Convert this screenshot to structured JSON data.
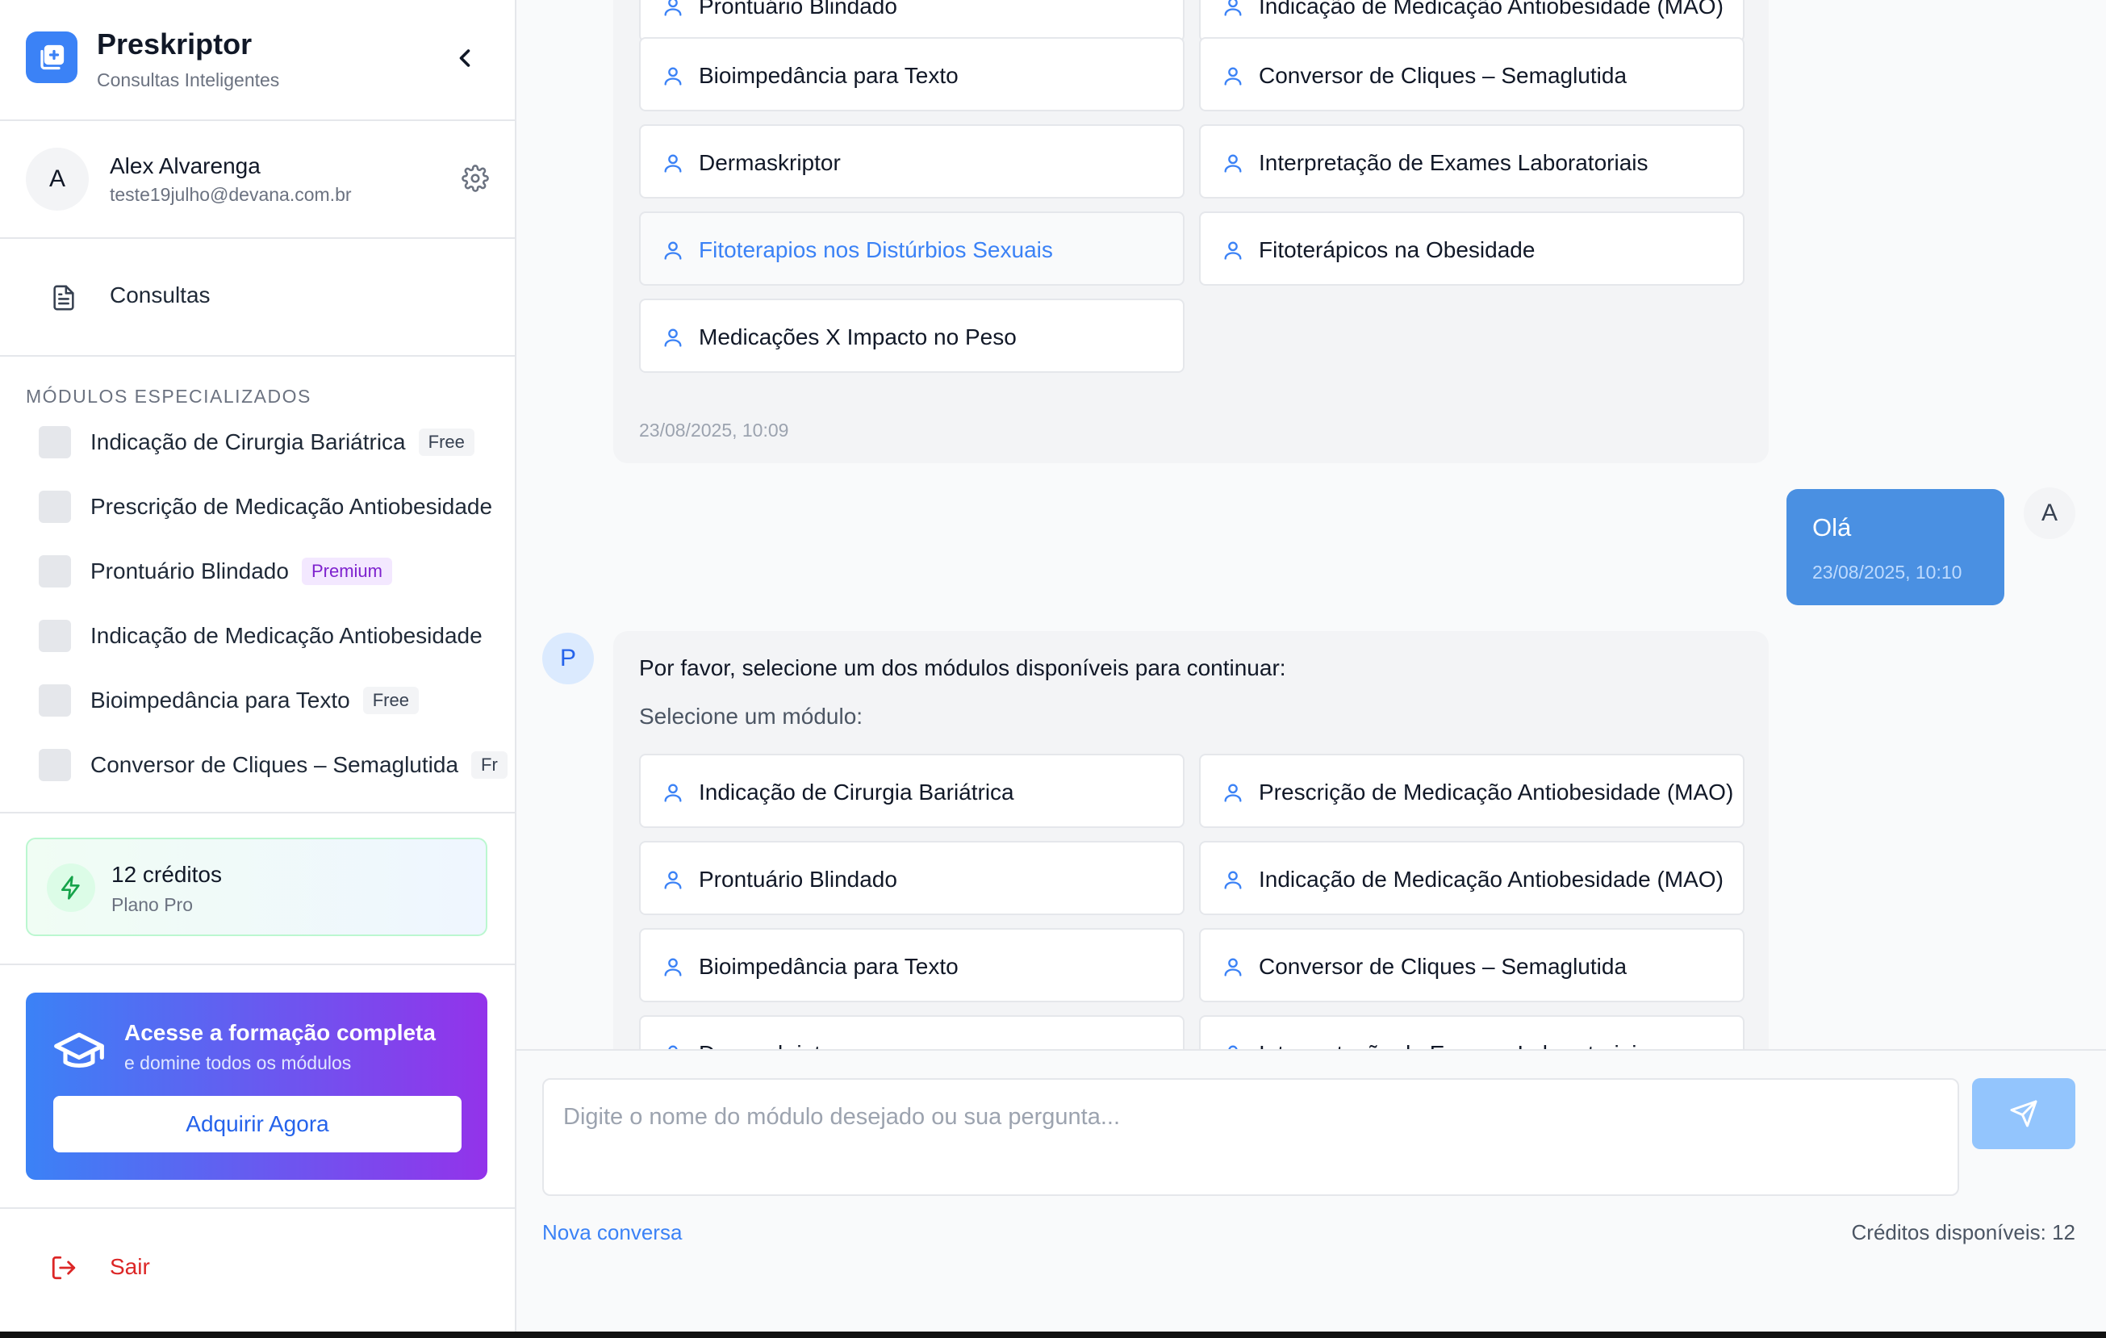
{
  "app": {
    "name": "Preskriptor",
    "subtitle": "Consultas Inteligentes"
  },
  "user": {
    "initial": "A",
    "name": "Alex Alvarenga",
    "email": "teste19julho@devana.com.br"
  },
  "nav": {
    "consultas": "Consultas"
  },
  "modules": {
    "section_title": "MÓDULOS ESPECIALIZADOS",
    "items": [
      {
        "label": "Indicação de Cirurgia Bariátrica",
        "badge": "Free"
      },
      {
        "label": "Prescrição de Medicação Antiobesidade",
        "badge": ""
      },
      {
        "label": "Prontuário Blindado",
        "badge": "Premium"
      },
      {
        "label": "Indicação de Medicação Antiobesidade",
        "badge": ""
      },
      {
        "label": "Bioimpedância para Texto",
        "badge": "Free"
      },
      {
        "label": "Conversor de Cliques – Semaglutida",
        "badge": "Fr"
      }
    ]
  },
  "credits_card": {
    "amount": "12 créditos",
    "plan": "Plano Pro"
  },
  "promo": {
    "title": "Acesse a formação completa",
    "subtitle": "e domine todos os módulos",
    "button": "Adquirir Agora"
  },
  "logout": "Sair",
  "chat": {
    "first_bot": {
      "modules": [
        "Prontuário Blindado",
        "Indicação de Medicação Antiobesidade (MAO)",
        "Bioimpedância para Texto",
        "Conversor de Cliques – Semaglutida",
        "Dermaskriptor",
        "Interpretação de Exames Laboratoriais",
        "Fitoterapios nos Distúrbios Sexuais",
        "Fitoterápicos na Obesidade",
        "Medicações X Impacto no Peso"
      ],
      "timestamp": "23/08/2025, 10:09"
    },
    "user_msg": {
      "text": "Olá",
      "timestamp": "23/08/2025, 10:10",
      "avatar": "A"
    },
    "second_bot": {
      "avatar": "P",
      "intro": "Por favor, selecione um dos módulos disponíveis para continuar:",
      "select_hint": "Selecione um módulo:",
      "modules": [
        "Indicação de Cirurgia Bariátrica",
        "Prescrição de Medicação Antiobesidade (MAO)",
        "Prontuário Blindado",
        "Indicação de Medicação Antiobesidade (MAO)",
        "Bioimpedância para Texto",
        "Conversor de Cliques – Semaglutida",
        "Dermaskriptor",
        "Interpretação de Exames Laboratoriais"
      ]
    }
  },
  "input": {
    "placeholder": "Digite o nome do módulo desejado ou sua pergunta...",
    "value": "",
    "new_chat": "Nova conversa",
    "credits": "Créditos disponíveis: 12"
  },
  "colors": {
    "accent": "#3b82f6",
    "user_bubble": "#4a90e2",
    "danger": "#dc2626",
    "premium": "#7e22ce"
  },
  "icons": [
    "logo-icon",
    "chevron-left-icon",
    "gear-icon",
    "document-icon",
    "bolt-icon",
    "graduation-cap-icon",
    "logout-icon",
    "user-icon",
    "send-icon"
  ]
}
